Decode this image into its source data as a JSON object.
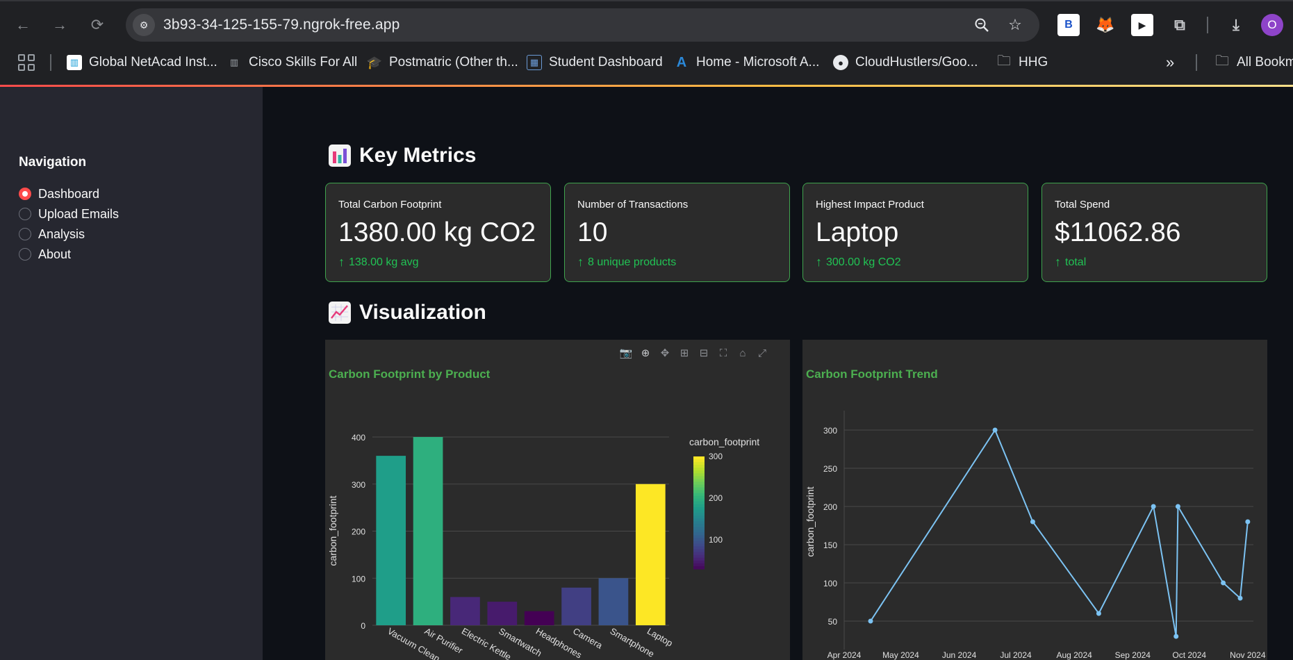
{
  "browser": {
    "url": "3b93-34-125-155-79.ngrok-free.app",
    "extensions": [
      "B"
    ],
    "profile_initial": "O",
    "bookmarks": [
      {
        "label": "Global NetAcad Inst...",
        "icon": "cisco-icon"
      },
      {
        "label": "Cisco Skills For All",
        "icon": "cisco-icon"
      },
      {
        "label": "Postmatric (Other th...",
        "icon": "graduate-icon"
      },
      {
        "label": "Student Dashboard",
        "icon": "dashboard-icon"
      },
      {
        "label": "Home - Microsoft A...",
        "icon": "azure-icon"
      },
      {
        "label": "CloudHustlers/Goo...",
        "icon": "github-icon"
      },
      {
        "label": "HHG",
        "icon": "folder-icon"
      }
    ],
    "all_bookmarks": "All Bookm"
  },
  "sidebar": {
    "title": "Navigation",
    "options": [
      "Dashboard",
      "Upload Emails",
      "Analysis",
      "About"
    ],
    "selected": "Dashboard"
  },
  "main": {
    "metrics_title": "Key Metrics",
    "metrics": [
      {
        "label": "Total Carbon Footprint",
        "value": "1380.00 kg CO2",
        "delta": "138.00 kg avg"
      },
      {
        "label": "Number of Transactions",
        "value": "10",
        "delta": "8 unique products"
      },
      {
        "label": "Highest Impact Product",
        "value": "Laptop",
        "delta": "300.00 kg CO2"
      },
      {
        "label": "Total Spend",
        "value": "$11062.86",
        "delta": "total"
      }
    ],
    "viz_title": "Visualization"
  },
  "colors": {
    "accent_green": "#4caf50",
    "metric_border": "#3fa34d",
    "delta_green": "#21c354",
    "radio_red": "#ff4b4b",
    "line_blue": "#7cc3f3"
  },
  "chart_data": [
    {
      "type": "bar",
      "title": "Carbon Footprint by Product",
      "ylabel": "carbon_footprint",
      "xlabel": "",
      "categories": [
        "Vacuum Cleaner",
        "Air Purifier",
        "Electric Kettle",
        "Smartwatch",
        "Headphones",
        "Camera",
        "Smartphone",
        "Laptop"
      ],
      "tick_labels_visible": [
        "Vacuum Clean...",
        "Air Purifier",
        "Electric Kettle",
        "Smartwatch",
        "Headphones",
        "Camera",
        "Smartphone",
        "Laptop"
      ],
      "values": [
        360,
        400,
        60,
        50,
        30,
        80,
        100,
        300
      ],
      "color_values": [
        180,
        200,
        60,
        50,
        30,
        80,
        100,
        300
      ],
      "ylim": [
        0,
        400
      ],
      "yticks": [
        0,
        100,
        200,
        300,
        400
      ],
      "colorbar": {
        "title": "carbon_footprint",
        "ticks": [
          100,
          200,
          300
        ],
        "range": [
          30,
          300
        ],
        "colorscale": "Viridis"
      },
      "grid": true
    },
    {
      "type": "line",
      "title": "Carbon Footprint Trend",
      "ylabel": "carbon_footprint",
      "xlabel": "",
      "x": [
        "2024-04-15",
        "2024-06-20",
        "2024-07-10",
        "2024-08-14",
        "2024-09-12",
        "2024-09-24",
        "2024-09-25",
        "2024-10-19",
        "2024-10-28",
        "2024-11-01"
      ],
      "y": [
        50,
        300,
        180,
        60,
        200,
        30,
        200,
        100,
        80,
        180
      ],
      "x_ticks": [
        "Apr 2024",
        "May 2024",
        "Jun 2024",
        "Jul 2024",
        "Aug 2024",
        "Sep 2024",
        "Oct 2024",
        "Nov 2024"
      ],
      "x_tick_dates": [
        "2024-04-01",
        "2024-05-01",
        "2024-06-01",
        "2024-07-01",
        "2024-08-01",
        "2024-09-01",
        "2024-10-01",
        "2024-11-01"
      ],
      "xlim": [
        "2024-04-01",
        "2024-11-04"
      ],
      "yticks": [
        50,
        100,
        150,
        200,
        250,
        300
      ],
      "ylim": [
        20,
        320
      ],
      "grid": true
    }
  ]
}
